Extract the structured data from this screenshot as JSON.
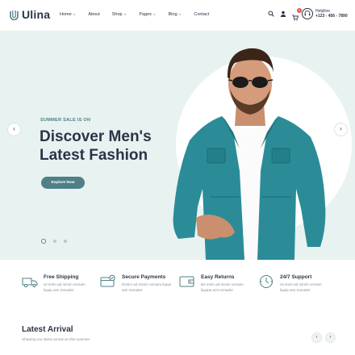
{
  "brand": {
    "name": "Ulina",
    "accent": "#4e8086",
    "dark": "#2b3445",
    "hero_bg": "#e8f2f1",
    "badge_red": "#e5544b"
  },
  "nav": [
    {
      "label": "Home",
      "chevron": true
    },
    {
      "label": "About",
      "chevron": false
    },
    {
      "label": "Shop",
      "chevron": true
    },
    {
      "label": "Pages",
      "chevron": true
    },
    {
      "label": "Blog",
      "chevron": true
    },
    {
      "label": "Contact",
      "chevron": false
    }
  ],
  "header_icons": {
    "search": "search-icon",
    "user": "user-icon",
    "cart": "cart-icon",
    "cart_count": "0"
  },
  "helpline": {
    "label": "Helpline",
    "number": "+123 - 456 - 7890",
    "icon": "headset-icon"
  },
  "hero": {
    "kicker": "SUMMER SALE IS ON",
    "title_line1": "Discover Men's",
    "title_line2": "Latest Fashion",
    "button": "Explore Now",
    "prev": "‹",
    "next": "›",
    "slides": 3,
    "active_slide": 1
  },
  "features": [
    {
      "icon": "truck-icon",
      "title": "Free Shipping",
      "desc": "Ut enim ad minim veniam liquip ami tomader"
    },
    {
      "icon": "card-icon",
      "title": "Secure Payments",
      "desc": "Eonim ad minim veniam liquip ami tomader"
    },
    {
      "icon": "wallet-icon",
      "title": "Easy Returns",
      "desc": "Be enim ad minim veniam liquipa ami tomader"
    },
    {
      "icon": "support-icon",
      "title": "24/7 Support",
      "desc": "Ut enim ad minim veniam liquip ami tomader"
    }
  ],
  "latest": {
    "title": "Latest Arrival",
    "subtitle": "Showing our latest arrival on this summer",
    "prev": "‹",
    "next": "›"
  }
}
